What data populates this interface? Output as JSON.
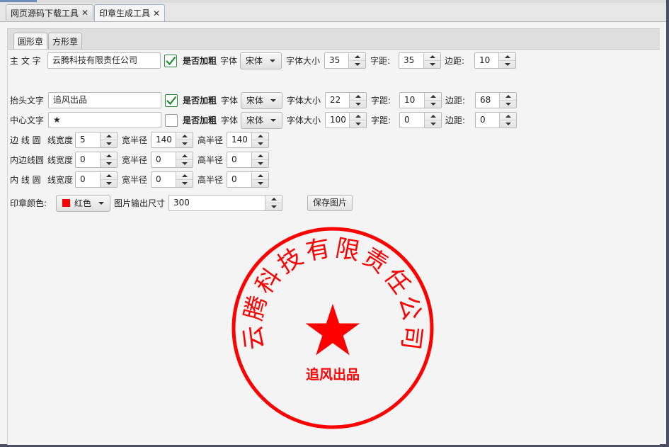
{
  "tabs": [
    {
      "label": "网页源码下载工具",
      "close": "✕"
    },
    {
      "label": "印章生成工具",
      "close": "✕"
    }
  ],
  "subtabs": [
    "圆形章",
    "方形章"
  ],
  "labels": {
    "bold": "是否加粗",
    "font": "字体",
    "font_size": "字体大小",
    "spacing": "字距:",
    "margin": "边距:",
    "line_width": "线宽度",
    "width_radius": "宽半径",
    "height_radius": "高半径"
  },
  "rows": {
    "main_text": {
      "label": "主 文 字",
      "value": "云腾科技有限责任公司",
      "bold": true,
      "font": "宋体",
      "size": "35",
      "spacing": "35",
      "margin": "10"
    },
    "header_text": {
      "label": "抬头文字",
      "value": "追风出品",
      "bold": true,
      "font": "宋体",
      "size": "22",
      "spacing": "10",
      "margin": "68"
    },
    "center_text": {
      "label": "中心文字",
      "value": "★",
      "bold": false,
      "font": "宋体",
      "size": "100",
      "spacing": "0",
      "margin": "0"
    }
  },
  "circles": {
    "border": {
      "label": "边 线 圆",
      "line_width": "5",
      "width_radius": "140",
      "height_radius": "140"
    },
    "inner_border": {
      "label": "内边线圆",
      "line_width": "0",
      "width_radius": "0",
      "height_radius": "0"
    },
    "inner": {
      "label": "内 线 圆",
      "line_width": "0",
      "width_radius": "0",
      "height_radius": "0"
    }
  },
  "output": {
    "color_label": "印章颜色:",
    "color_value": "红色",
    "color_hex": "#ff0000",
    "size_label": "图片输出尺寸",
    "size_value": "300",
    "save_button": "保存图片"
  },
  "seal": {
    "arc_chars": [
      "云",
      "腾",
      "科",
      "技",
      "有",
      "限",
      "责",
      "任",
      "公",
      "司"
    ],
    "center_symbol": "★",
    "header_text": "追风出品",
    "color": "#ff0000"
  }
}
